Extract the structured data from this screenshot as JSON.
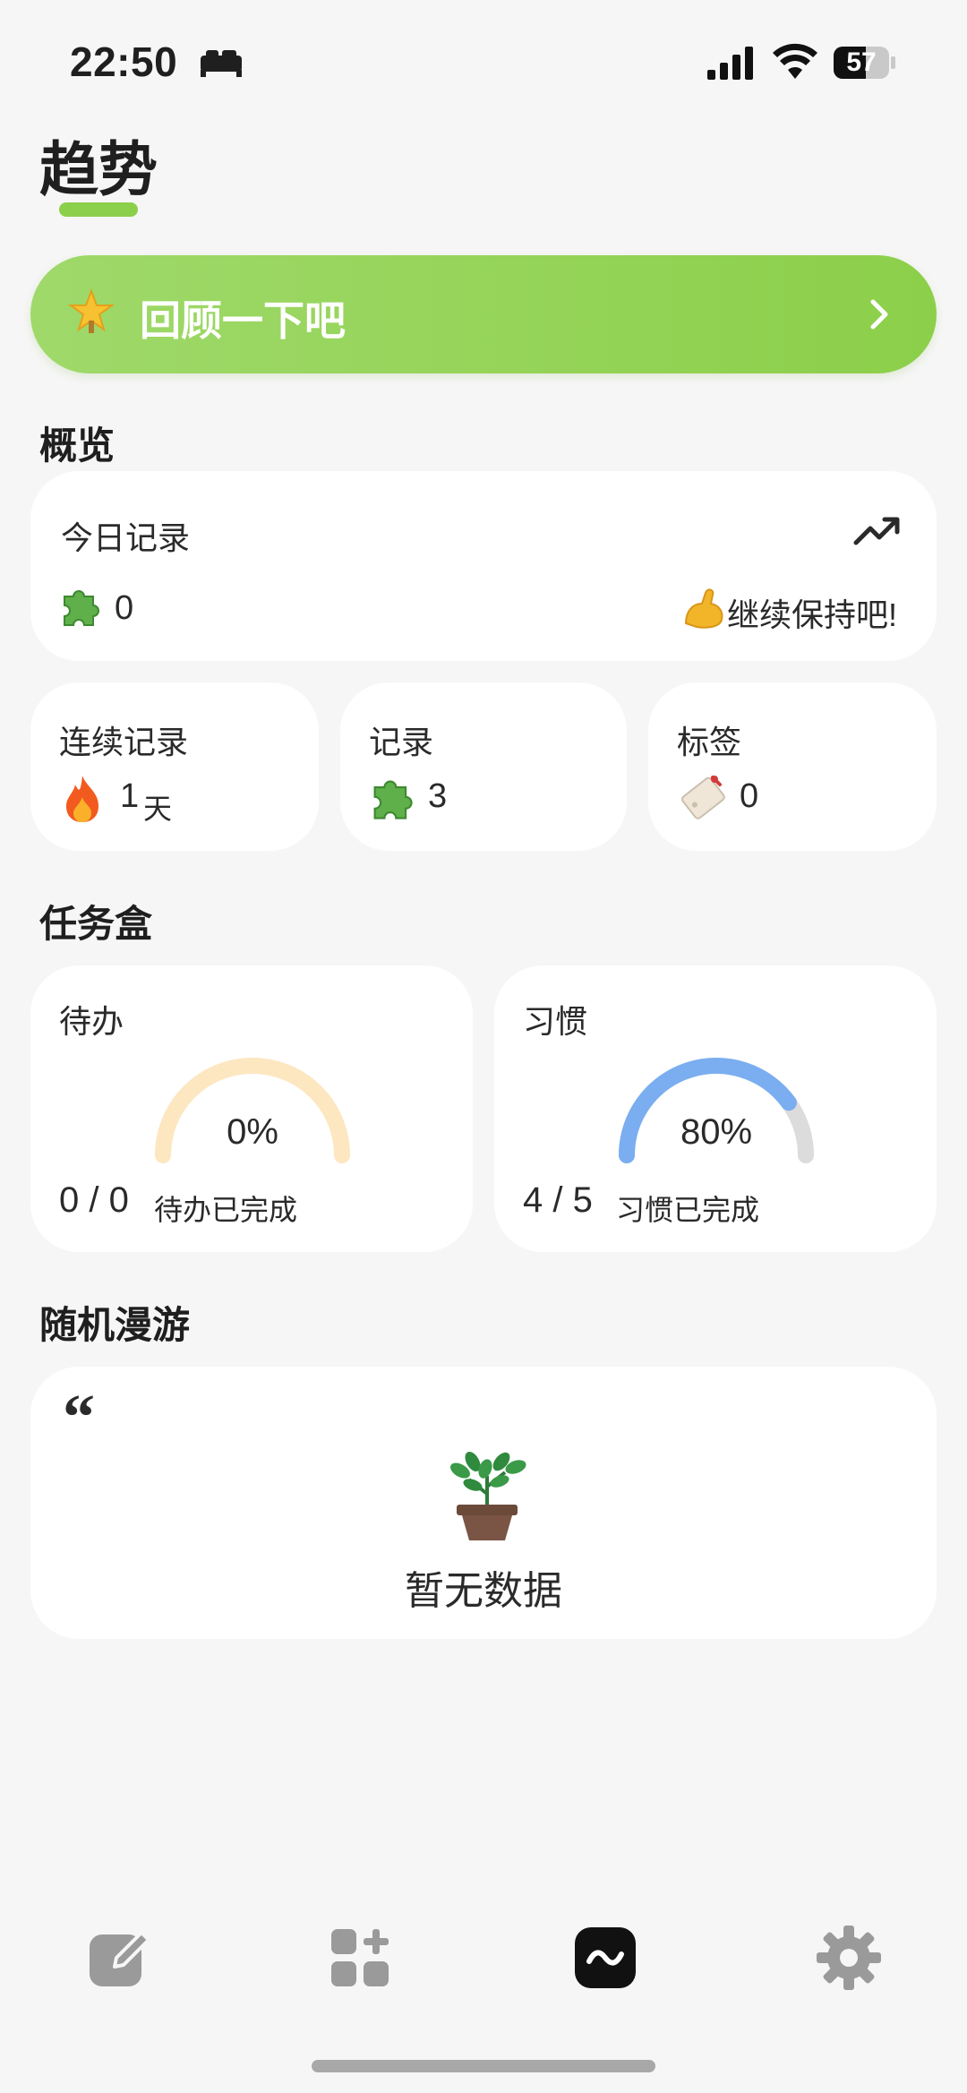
{
  "status_bar": {
    "time": "22:50",
    "battery": "57"
  },
  "header": {
    "title": "趋势"
  },
  "review_banner": {
    "label": "回顾一下吧"
  },
  "overview": {
    "section_title": "概览",
    "today": {
      "label": "今日记录",
      "count": "0",
      "encourage": "继续保持吧!"
    },
    "streak": {
      "label": "连续记录",
      "value": "1",
      "unit": "天"
    },
    "records": {
      "label": "记录",
      "value": "3"
    },
    "tags": {
      "label": "标签",
      "value": "0"
    }
  },
  "taskbox": {
    "section_title": "任务盒",
    "todo": {
      "label": "待办",
      "percent": "0%",
      "fraction": 0.0,
      "count": "0 / 0",
      "caption": "待办已完成"
    },
    "habit": {
      "label": "习惯",
      "percent": "80%",
      "fraction": 0.8,
      "count": "4 / 5",
      "caption": "习惯已完成"
    }
  },
  "random_walk": {
    "section_title": "随机漫游",
    "quote_mark": "“",
    "empty_text": "暂无数据"
  },
  "bottom_nav": [
    {
      "icon": "edit-note-icon",
      "active": false
    },
    {
      "icon": "widgets-add-icon",
      "active": false
    },
    {
      "icon": "trend-icon",
      "active": true
    },
    {
      "icon": "gear-icon",
      "active": false
    }
  ],
  "colors": {
    "accent_green": "#8ccf4a",
    "todo_track": "#fde7c1",
    "habit_progress": "#7aaef0",
    "habit_track": "#dcdcdc",
    "nav_inactive": "#9a9a9a",
    "nav_active": "#111111"
  }
}
